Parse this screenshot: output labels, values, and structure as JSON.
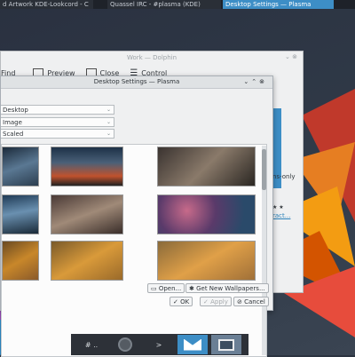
{
  "taskbar": {
    "tasks": [
      {
        "label": "d Artwork KDE-Lookcord - C"
      },
      {
        "label": "Quassel IRC - #plasma (KDE)"
      },
      {
        "label": "Desktop Settings — Plasma"
      }
    ]
  },
  "dolphin": {
    "title": "Work — Dolphin",
    "toolbar": {
      "find": "Find",
      "preview": "Preview",
      "close": "Close",
      "control": "Control"
    },
    "side_text_1": "ns-only",
    "side_stars": "★ ★",
    "side_link": "ract..."
  },
  "dialog": {
    "title": "Desktop Settings — Plasma",
    "layout_combo": "Desktop",
    "type_combo": "Image",
    "positioning_combo": "Scaled",
    "buttons": {
      "open": "Open...",
      "get_new": "Get New Wallpapers...",
      "ok": "OK",
      "apply": "Apply",
      "cancel": "Cancel"
    }
  },
  "panel": {
    "items": [
      "# ..",
      "",
      ">",
      "",
      ""
    ]
  },
  "colors": {
    "accent": "#3d8ec6",
    "window_bg": "#eff0f1",
    "panel_bg": "#2d3138"
  }
}
